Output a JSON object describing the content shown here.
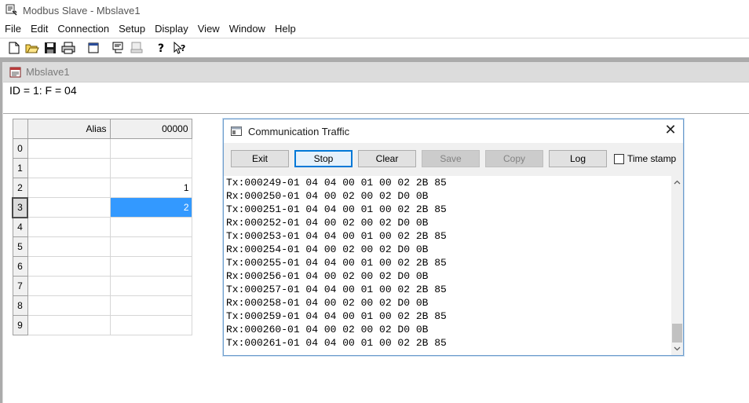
{
  "window": {
    "title": "Modbus Slave - Mbslave1"
  },
  "menu": [
    "File",
    "Edit",
    "Connection",
    "Setup",
    "Display",
    "View",
    "Window",
    "Help"
  ],
  "toolbar": {
    "icons": [
      "new-icon",
      "open-icon",
      "save-icon",
      "print-icon",
      "window-icon",
      "comm-icon",
      "disconnect-icon",
      "help-icon",
      "context-help-icon"
    ]
  },
  "child": {
    "title": "Mbslave1",
    "id_line": "ID = 1: F = 04"
  },
  "grid": {
    "headers": {
      "alias": "Alias",
      "col0": "00000"
    },
    "rows": [
      {
        "num": "0",
        "alias": "",
        "value": ""
      },
      {
        "num": "1",
        "alias": "",
        "value": ""
      },
      {
        "num": "2",
        "alias": "",
        "value": "1"
      },
      {
        "num": "3",
        "alias": "",
        "value": "2"
      },
      {
        "num": "4",
        "alias": "",
        "value": ""
      },
      {
        "num": "5",
        "alias": "",
        "value": ""
      },
      {
        "num": "6",
        "alias": "",
        "value": ""
      },
      {
        "num": "7",
        "alias": "",
        "value": ""
      },
      {
        "num": "8",
        "alias": "",
        "value": ""
      },
      {
        "num": "9",
        "alias": "",
        "value": ""
      }
    ],
    "selected_row": "3"
  },
  "traffic": {
    "title": "Communication Traffic",
    "close": "✕",
    "buttons": {
      "exit": "Exit",
      "stop": "Stop",
      "clear": "Clear",
      "save": "Save",
      "copy": "Copy",
      "log": "Log"
    },
    "timestamp_label": "Time stamp",
    "timestamp_checked": false,
    "lines": [
      "Tx:000249-01 04 04 00 01 00 02 2B 85",
      "Rx:000250-01 04 00 02 00 02 D0 0B",
      "Tx:000251-01 04 04 00 01 00 02 2B 85",
      "Rx:000252-01 04 00 02 00 02 D0 0B",
      "Tx:000253-01 04 04 00 01 00 02 2B 85",
      "Rx:000254-01 04 00 02 00 02 D0 0B",
      "Tx:000255-01 04 04 00 01 00 02 2B 85",
      "Rx:000256-01 04 00 02 00 02 D0 0B",
      "Tx:000257-01 04 04 00 01 00 02 2B 85",
      "Rx:000258-01 04 00 02 00 02 D0 0B",
      "Tx:000259-01 04 04 00 01 00 02 2B 85",
      "Rx:000260-01 04 00 02 00 02 D0 0B",
      "Tx:000261-01 04 04 00 01 00 02 2B 85"
    ]
  },
  "colors": {
    "selection": "#3399ff",
    "default_button_border": "#0078d7",
    "mdi_background": "#ababab"
  }
}
